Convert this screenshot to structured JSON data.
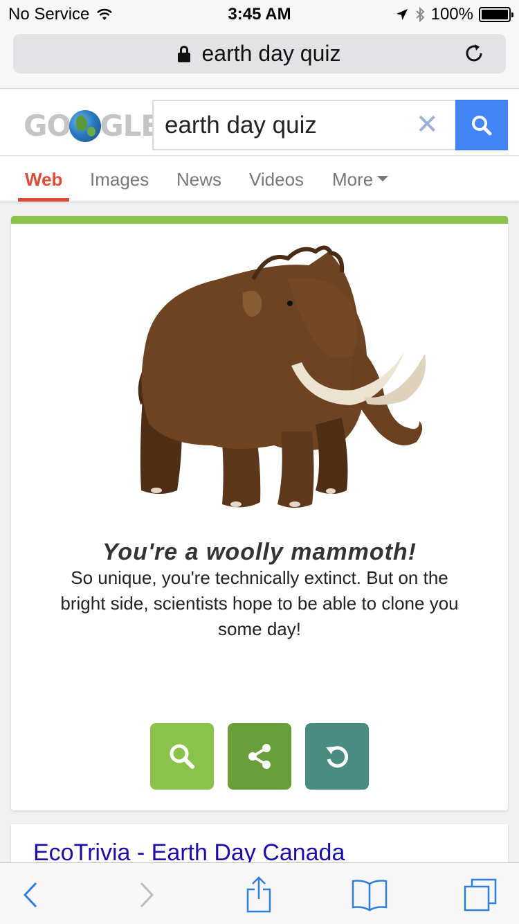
{
  "status_bar": {
    "carrier": "No Service",
    "time": "3:45 AM",
    "battery": "100%"
  },
  "url_bar": {
    "address": "earth day quiz"
  },
  "search": {
    "logo_left": "GO",
    "logo_right": "GLE",
    "query": "earth day quiz"
  },
  "tabs": [
    {
      "label": "Web",
      "active": true
    },
    {
      "label": "Images"
    },
    {
      "label": "News"
    },
    {
      "label": "Videos"
    },
    {
      "label": "More"
    }
  ],
  "result": {
    "title": "You're a woolly mammoth!",
    "description": "So unique, you're technically extinct. But on the bright side, scientists hope to be able to clone you some day!",
    "accent_color": "#8bc34a"
  },
  "next_result": {
    "title": "EcoTrivia - Earth Day Canada"
  },
  "colors": {
    "search_button": "#4285f4",
    "active_tab": "#dd4b39",
    "link": "#1a0dab",
    "toolbar_icon": "#2f7ddb"
  }
}
